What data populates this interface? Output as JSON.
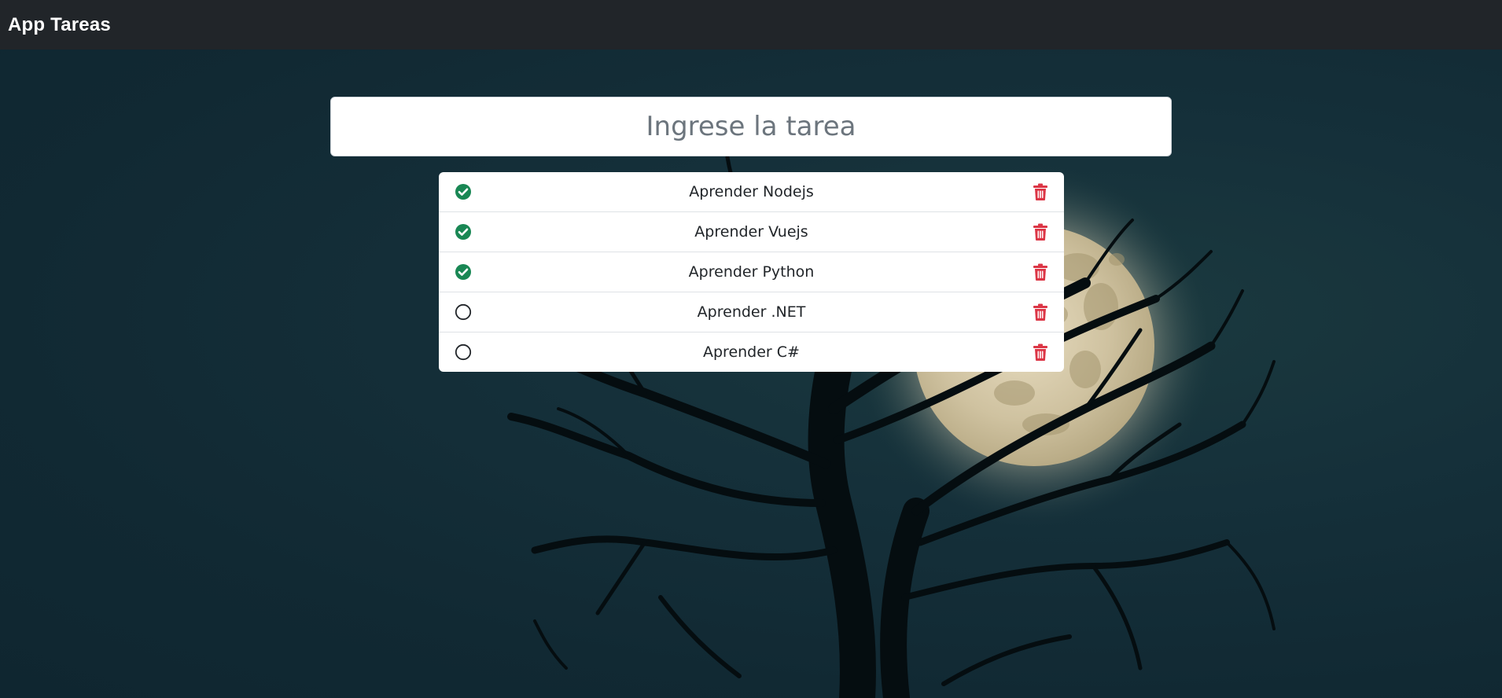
{
  "navbar": {
    "brand": "App Tareas"
  },
  "task_input": {
    "placeholder": "Ingrese la tarea",
    "value": ""
  },
  "tasks": [
    {
      "label": "Aprender Nodejs",
      "done": true
    },
    {
      "label": "Aprender Vuejs",
      "done": true
    },
    {
      "label": "Aprender Python",
      "done": true
    },
    {
      "label": "Aprender .NET",
      "done": false
    },
    {
      "label": "Aprender C#",
      "done": false
    }
  ],
  "icons": {
    "done": "check-circle-icon",
    "pending": "circle-icon",
    "delete": "trash-icon"
  },
  "colors": {
    "navbar_bg": "#212529",
    "done_green": "#198754",
    "delete_red": "#dc3545",
    "background": "#112933"
  }
}
